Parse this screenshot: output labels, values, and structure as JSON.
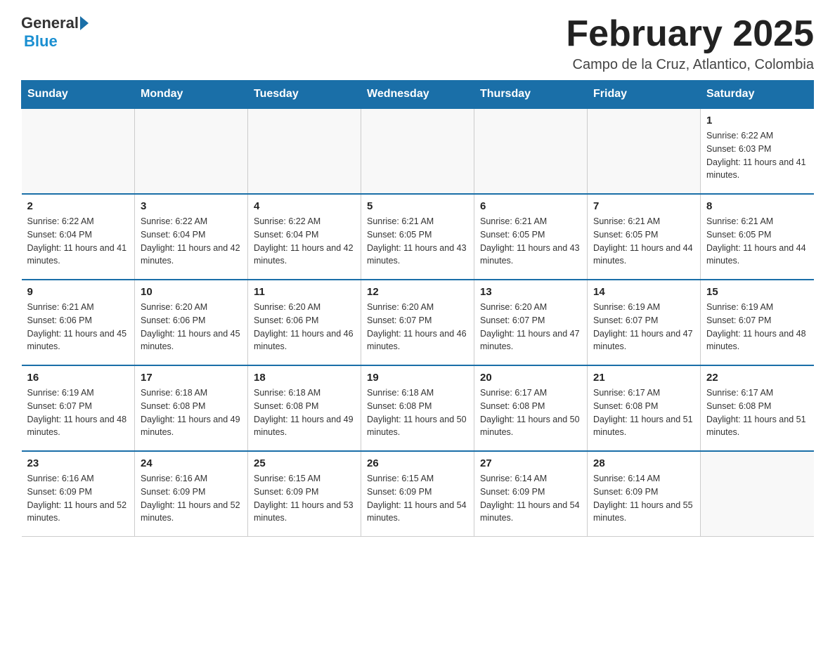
{
  "header": {
    "logo": {
      "general": "General",
      "blue": "Blue"
    },
    "title": "February 2025",
    "location": "Campo de la Cruz, Atlantico, Colombia"
  },
  "days_of_week": [
    "Sunday",
    "Monday",
    "Tuesday",
    "Wednesday",
    "Thursday",
    "Friday",
    "Saturday"
  ],
  "weeks": [
    [
      {
        "day": "",
        "info": ""
      },
      {
        "day": "",
        "info": ""
      },
      {
        "day": "",
        "info": ""
      },
      {
        "day": "",
        "info": ""
      },
      {
        "day": "",
        "info": ""
      },
      {
        "day": "",
        "info": ""
      },
      {
        "day": "1",
        "info": "Sunrise: 6:22 AM\nSunset: 6:03 PM\nDaylight: 11 hours and 41 minutes."
      }
    ],
    [
      {
        "day": "2",
        "info": "Sunrise: 6:22 AM\nSunset: 6:04 PM\nDaylight: 11 hours and 41 minutes."
      },
      {
        "day": "3",
        "info": "Sunrise: 6:22 AM\nSunset: 6:04 PM\nDaylight: 11 hours and 42 minutes."
      },
      {
        "day": "4",
        "info": "Sunrise: 6:22 AM\nSunset: 6:04 PM\nDaylight: 11 hours and 42 minutes."
      },
      {
        "day": "5",
        "info": "Sunrise: 6:21 AM\nSunset: 6:05 PM\nDaylight: 11 hours and 43 minutes."
      },
      {
        "day": "6",
        "info": "Sunrise: 6:21 AM\nSunset: 6:05 PM\nDaylight: 11 hours and 43 minutes."
      },
      {
        "day": "7",
        "info": "Sunrise: 6:21 AM\nSunset: 6:05 PM\nDaylight: 11 hours and 44 minutes."
      },
      {
        "day": "8",
        "info": "Sunrise: 6:21 AM\nSunset: 6:05 PM\nDaylight: 11 hours and 44 minutes."
      }
    ],
    [
      {
        "day": "9",
        "info": "Sunrise: 6:21 AM\nSunset: 6:06 PM\nDaylight: 11 hours and 45 minutes."
      },
      {
        "day": "10",
        "info": "Sunrise: 6:20 AM\nSunset: 6:06 PM\nDaylight: 11 hours and 45 minutes."
      },
      {
        "day": "11",
        "info": "Sunrise: 6:20 AM\nSunset: 6:06 PM\nDaylight: 11 hours and 46 minutes."
      },
      {
        "day": "12",
        "info": "Sunrise: 6:20 AM\nSunset: 6:07 PM\nDaylight: 11 hours and 46 minutes."
      },
      {
        "day": "13",
        "info": "Sunrise: 6:20 AM\nSunset: 6:07 PM\nDaylight: 11 hours and 47 minutes."
      },
      {
        "day": "14",
        "info": "Sunrise: 6:19 AM\nSunset: 6:07 PM\nDaylight: 11 hours and 47 minutes."
      },
      {
        "day": "15",
        "info": "Sunrise: 6:19 AM\nSunset: 6:07 PM\nDaylight: 11 hours and 48 minutes."
      }
    ],
    [
      {
        "day": "16",
        "info": "Sunrise: 6:19 AM\nSunset: 6:07 PM\nDaylight: 11 hours and 48 minutes."
      },
      {
        "day": "17",
        "info": "Sunrise: 6:18 AM\nSunset: 6:08 PM\nDaylight: 11 hours and 49 minutes."
      },
      {
        "day": "18",
        "info": "Sunrise: 6:18 AM\nSunset: 6:08 PM\nDaylight: 11 hours and 49 minutes."
      },
      {
        "day": "19",
        "info": "Sunrise: 6:18 AM\nSunset: 6:08 PM\nDaylight: 11 hours and 50 minutes."
      },
      {
        "day": "20",
        "info": "Sunrise: 6:17 AM\nSunset: 6:08 PM\nDaylight: 11 hours and 50 minutes."
      },
      {
        "day": "21",
        "info": "Sunrise: 6:17 AM\nSunset: 6:08 PM\nDaylight: 11 hours and 51 minutes."
      },
      {
        "day": "22",
        "info": "Sunrise: 6:17 AM\nSunset: 6:08 PM\nDaylight: 11 hours and 51 minutes."
      }
    ],
    [
      {
        "day": "23",
        "info": "Sunrise: 6:16 AM\nSunset: 6:09 PM\nDaylight: 11 hours and 52 minutes."
      },
      {
        "day": "24",
        "info": "Sunrise: 6:16 AM\nSunset: 6:09 PM\nDaylight: 11 hours and 52 minutes."
      },
      {
        "day": "25",
        "info": "Sunrise: 6:15 AM\nSunset: 6:09 PM\nDaylight: 11 hours and 53 minutes."
      },
      {
        "day": "26",
        "info": "Sunrise: 6:15 AM\nSunset: 6:09 PM\nDaylight: 11 hours and 54 minutes."
      },
      {
        "day": "27",
        "info": "Sunrise: 6:14 AM\nSunset: 6:09 PM\nDaylight: 11 hours and 54 minutes."
      },
      {
        "day": "28",
        "info": "Sunrise: 6:14 AM\nSunset: 6:09 PM\nDaylight: 11 hours and 55 minutes."
      },
      {
        "day": "",
        "info": ""
      }
    ]
  ]
}
